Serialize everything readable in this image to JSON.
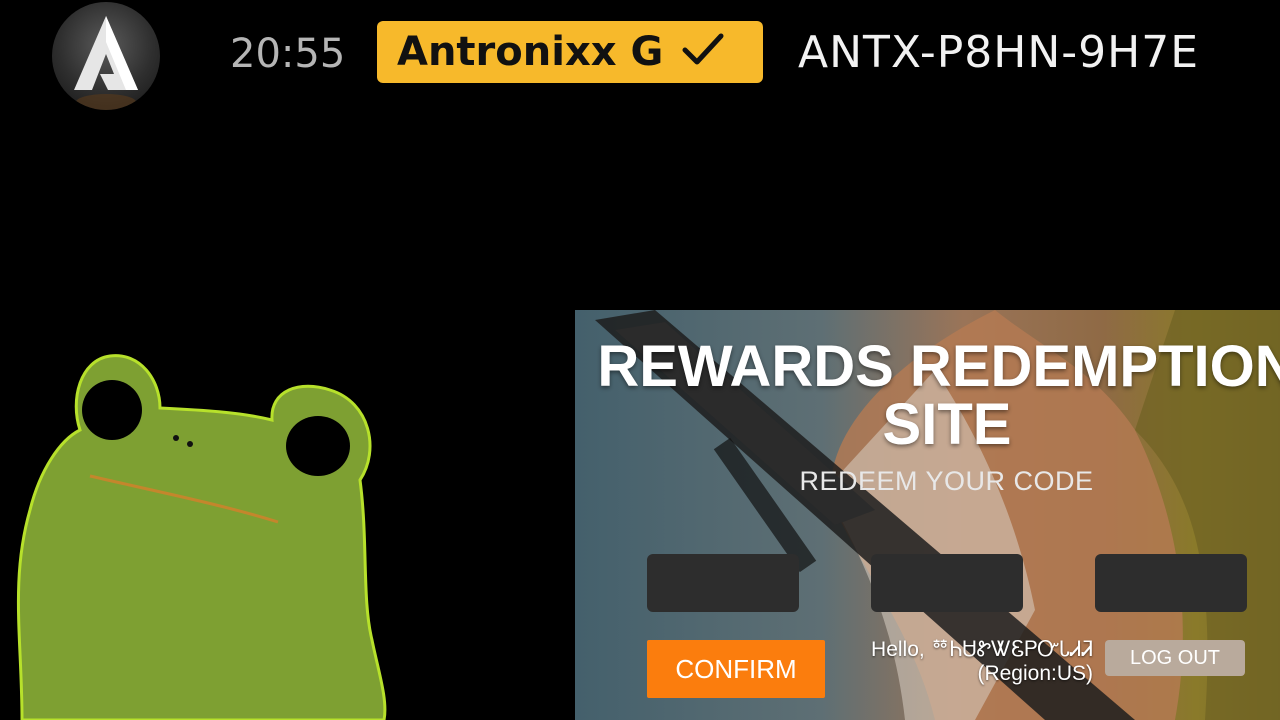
{
  "overlay": {
    "clock": "20:55",
    "user_name": "Antronixx G",
    "creator_code": "ANTX-P8HN-9H7E",
    "badge_color": "#f7b92b",
    "logo_icon": "antronixx-logo",
    "check_icon": "check-icon"
  },
  "site": {
    "title_line1": "REWARDS REDEMPTION",
    "title_line2": "SITE",
    "subtitle": "REDEEM YOUR CODE",
    "code_inputs": [
      {
        "value": "",
        "placeholder": ""
      },
      {
        "value": "",
        "placeholder": ""
      },
      {
        "value": "",
        "placeholder": ""
      }
    ],
    "confirm_label": "CONFIRM",
    "greeting_line1": "Hello, ᅘᏂᏌᏑᏔᏋᏢᏅᏓᏗᏘ",
    "greeting_line2": "(Region:US)",
    "logout_label": "LOG OUT",
    "accent_color": "#fb7d0d"
  }
}
